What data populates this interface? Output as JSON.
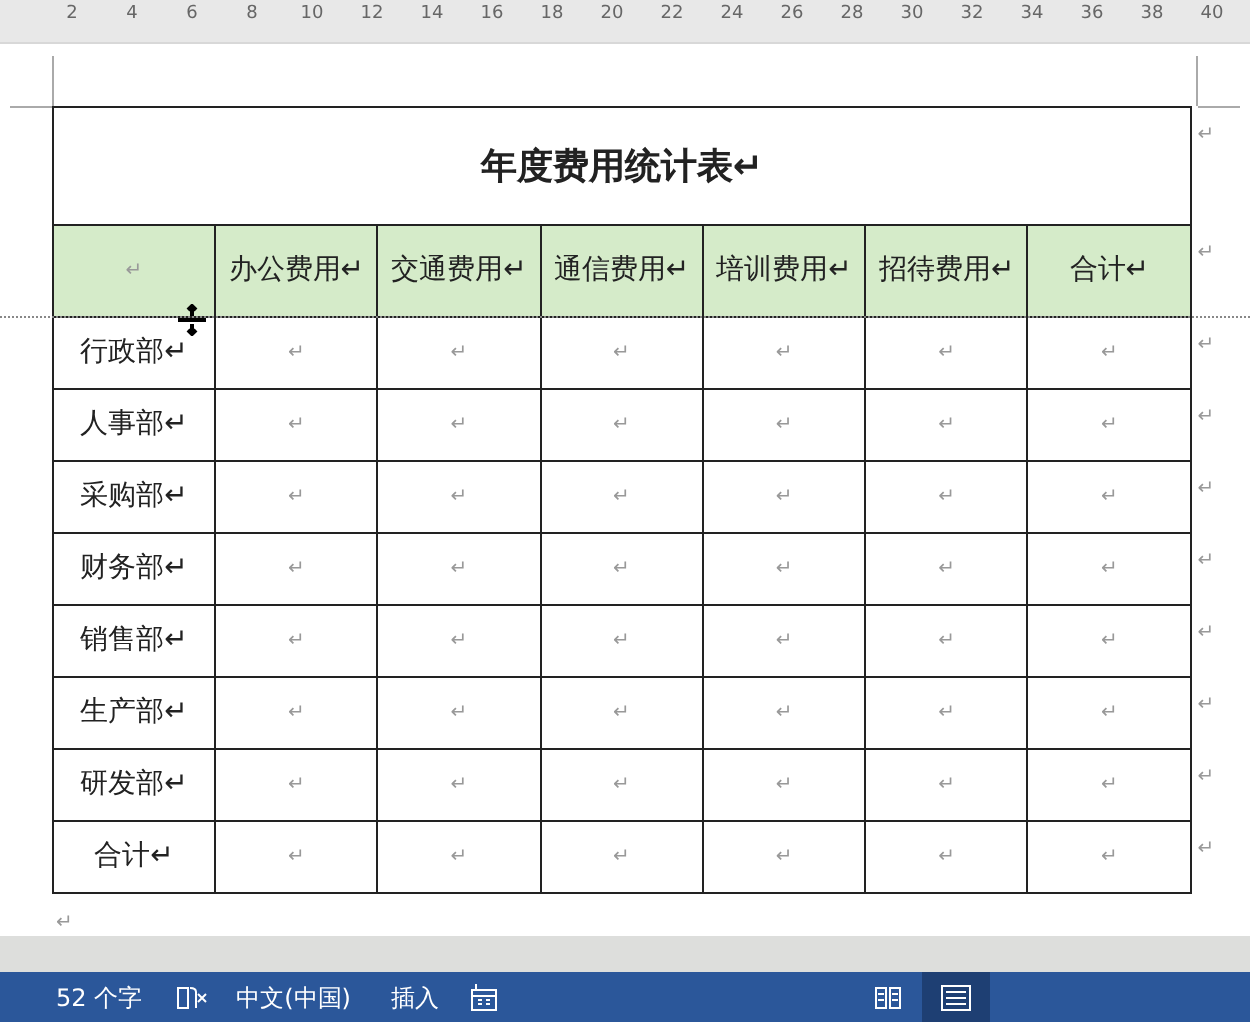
{
  "ruler": {
    "numbers": [
      "2",
      "4",
      "6",
      "8",
      "10",
      "12",
      "14",
      "16",
      "18",
      "20",
      "22",
      "24",
      "26",
      "28",
      "30",
      "32",
      "34",
      "36",
      "38",
      "40"
    ]
  },
  "table": {
    "title": "年度费用统计表↵",
    "columns": [
      "↵",
      "办公费用↵",
      "交通费用↵",
      "通信费用↵",
      "培训费用↵",
      "招待费用↵",
      "合计↵"
    ],
    "rows": [
      [
        "行政部↵",
        "↵",
        "↵",
        "↵",
        "↵",
        "↵",
        "↵"
      ],
      [
        "人事部↵",
        "↵",
        "↵",
        "↵",
        "↵",
        "↵",
        "↵"
      ],
      [
        "采购部↵",
        "↵",
        "↵",
        "↵",
        "↵",
        "↵",
        "↵"
      ],
      [
        "财务部↵",
        "↵",
        "↵",
        "↵",
        "↵",
        "↵",
        "↵"
      ],
      [
        "销售部↵",
        "↵",
        "↵",
        "↵",
        "↵",
        "↵",
        "↵"
      ],
      [
        "生产部↵",
        "↵",
        "↵",
        "↵",
        "↵",
        "↵",
        "↵"
      ],
      [
        "研发部↵",
        "↵",
        "↵",
        "↵",
        "↵",
        "↵",
        "↵"
      ],
      [
        "合计↵",
        "↵",
        "↵",
        "↵",
        "↵",
        "↵",
        "↵"
      ]
    ],
    "row_end_marks": [
      "↵",
      "↵",
      "↵",
      "↵",
      "↵",
      "↵",
      "↵",
      "↵",
      "↵",
      "↵"
    ]
  },
  "paragraph_mark": "↵",
  "status_bar": {
    "word_count": "52 个字",
    "language": "中文(中国)",
    "mode": "插入",
    "views": [
      {
        "kind": "read",
        "selected": false
      },
      {
        "kind": "print",
        "selected": true
      }
    ]
  }
}
